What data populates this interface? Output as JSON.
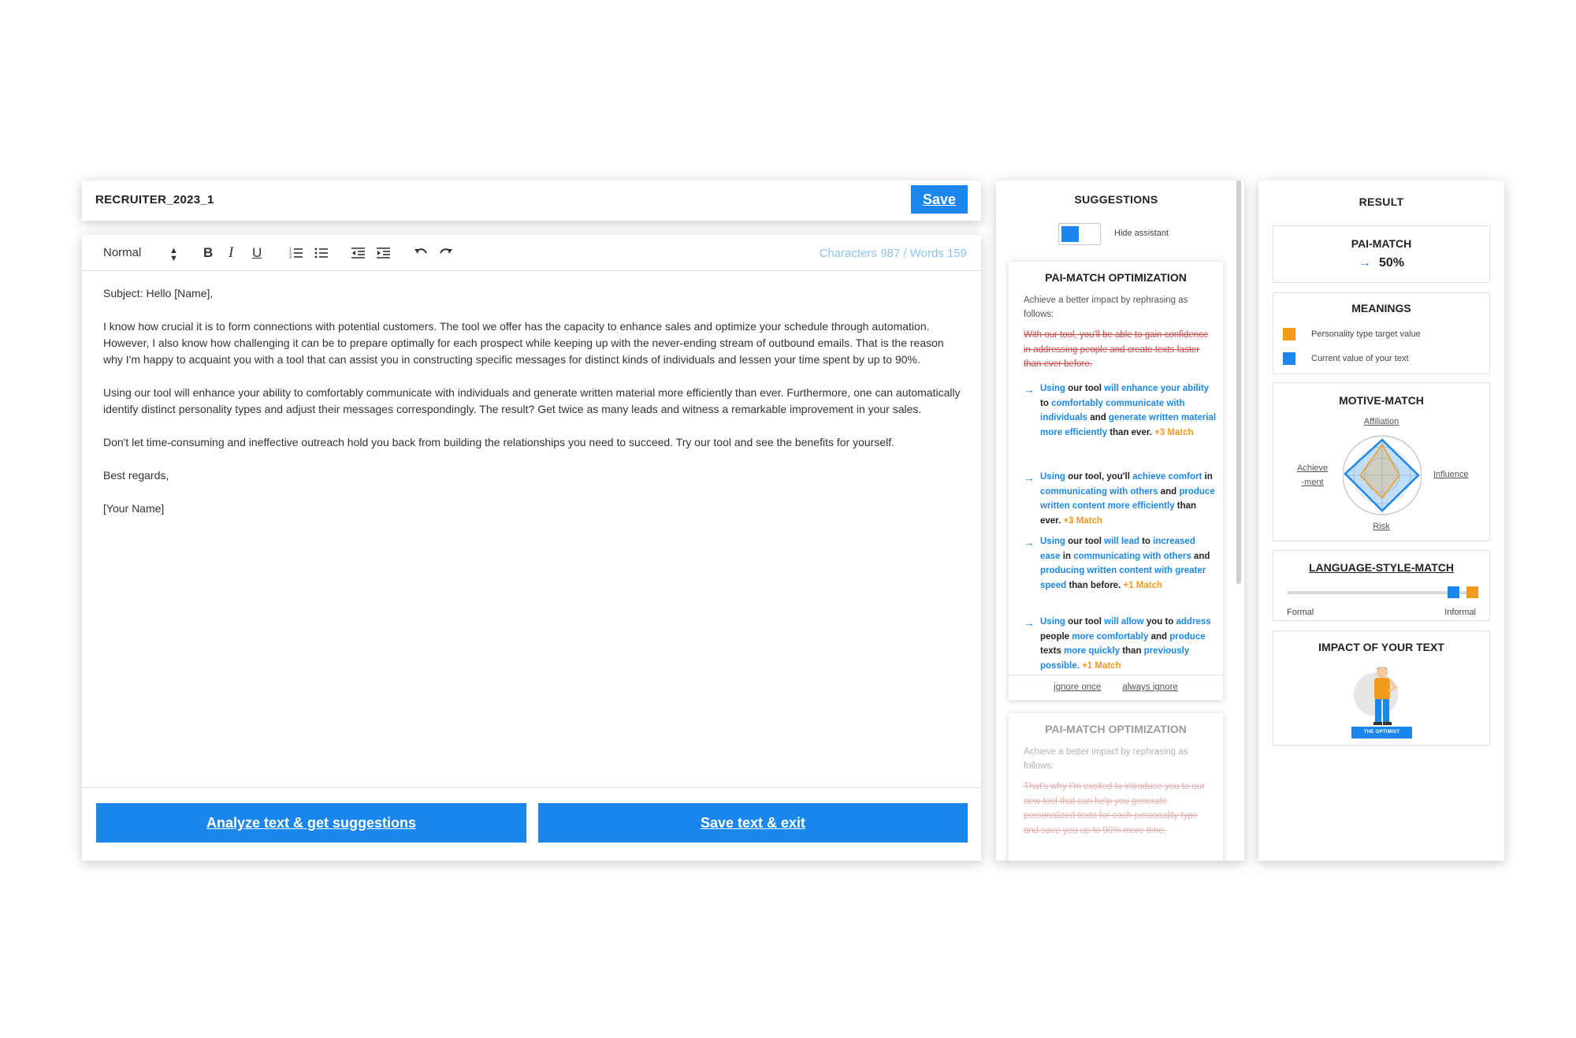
{
  "editor": {
    "doc_title": "RECRUITER_2023_1",
    "save_label": "Save",
    "toolbar": {
      "format_value": "Normal",
      "bold": "B",
      "italic": "I",
      "underline": "U",
      "counter": "Characters 987 / Words 159"
    },
    "paragraphs": [
      "Subject: Hello [Name],",
      "I know how crucial it is to form connections with potential customers. The tool we offer has the capacity to enhance sales and optimize your schedule through automation. However, I also know how challenging it can be to prepare optimally for each prospect while keeping up with the never-ending stream of outbound emails. That is the reason why I'm happy to acquaint you with a tool that can assist you in constructing specific messages for distinct kinds of individuals and lessen your time spent by up to 90%.",
      "Using our tool will enhance your ability to comfortably communicate with individuals and generate written material more efficiently than ever. Furthermore, one can automatically identify distinct personality types and adjust their messages correspondingly. The result? Get twice as many leads and witness a remarkable improvement in your sales.",
      "Don't let time-consuming and ineffective outreach hold you back from building the relationships you need to succeed. Try our tool and see the benefits for yourself.",
      "Best regards,",
      "[Your Name]"
    ],
    "analyze_label": "Analyze text & get suggestions",
    "save_exit_label": "Save text & exit"
  },
  "suggestions": {
    "title": "SUGGESTIONS",
    "hide_label": "Hide assistant",
    "card1": {
      "title": "PAI-MATCH OPTIMIZATION",
      "intro": "Achieve a better impact by rephrasing as follows:",
      "original": "With our tool, you'll be able to gain confidence in addressing people and create texts faster than ever before.",
      "items": [
        {
          "segments": [
            [
              "Using",
              "b"
            ],
            [
              " our tool ",
              "n"
            ],
            [
              "will enhance your ability",
              "b"
            ],
            [
              " to ",
              "n"
            ],
            [
              "comfortably communicate with individuals",
              "b"
            ],
            [
              " and ",
              "n"
            ],
            [
              "generate written material more efficiently",
              "b"
            ],
            [
              " than ever. ",
              "n"
            ],
            [
              "+3 Match",
              "m"
            ]
          ]
        },
        {
          "segments": [
            [
              "Using",
              "b"
            ],
            [
              " our tool, you'll ",
              "n"
            ],
            [
              "achieve comfort",
              "b"
            ],
            [
              " in ",
              "n"
            ],
            [
              "communicating with others",
              "b"
            ],
            [
              " and ",
              "n"
            ],
            [
              "produce written content more efficiently",
              "b"
            ],
            [
              " than ever. ",
              "n"
            ],
            [
              "+3 Match",
              "m"
            ]
          ]
        },
        {
          "segments": [
            [
              "Using",
              "b"
            ],
            [
              " our tool ",
              "n"
            ],
            [
              "will lead",
              "b"
            ],
            [
              " to ",
              "n"
            ],
            [
              "increased ease",
              "b"
            ],
            [
              " in ",
              "n"
            ],
            [
              "communicating with others",
              "b"
            ],
            [
              " and ",
              "n"
            ],
            [
              "producing written content with greater speed",
              "b"
            ],
            [
              " than before. ",
              "n"
            ],
            [
              "+1 Match",
              "m"
            ]
          ]
        },
        {
          "segments": [
            [
              "Using",
              "b"
            ],
            [
              " our tool ",
              "n"
            ],
            [
              "will allow",
              "b"
            ],
            [
              " you to ",
              "n"
            ],
            [
              "address",
              "b"
            ],
            [
              " people ",
              "n"
            ],
            [
              "more comfortably",
              "b"
            ],
            [
              " and ",
              "n"
            ],
            [
              "produce",
              "b"
            ],
            [
              " texts ",
              "n"
            ],
            [
              "more quickly",
              "b"
            ],
            [
              " than ",
              "n"
            ],
            [
              "previously possible.",
              "b"
            ],
            [
              " ",
              "n"
            ],
            [
              "+1 Match",
              "m"
            ]
          ]
        }
      ],
      "ignore_once": "ignore once",
      "always_ignore": "always ignore"
    },
    "card2": {
      "title": "PAI-MATCH OPTIMIZATION",
      "intro": "Achieve a better impact by rephrasing as follows:",
      "original": "That's why I'm excited to introduce you to our new tool that can help you generate personalized texts for each personality type and save you up to 90% more time."
    }
  },
  "result": {
    "title": "RESULT",
    "pai_match": {
      "label": "PAI-MATCH",
      "value": "50%"
    },
    "meanings": {
      "label": "MEANINGS",
      "target_label": "Personality type target value",
      "current_label": "Current value of your text",
      "target_color": "#f49a1c",
      "current_color": "#1b87ec"
    },
    "motive_match": {
      "label": "MOTIVE-MATCH",
      "axis_affiliation": "Affiliation",
      "axis_achievement": "Achieve\n-ment",
      "axis_influence": "Influence",
      "axis_risk": "Risk"
    },
    "language_style": {
      "label": "LANGUAGE-STYLE-MATCH",
      "formal": "Formal",
      "informal": "Informal"
    },
    "impact": {
      "label": "IMPACT OF YOUR TEXT",
      "persona_tag": "THE OPTIMIST"
    }
  }
}
